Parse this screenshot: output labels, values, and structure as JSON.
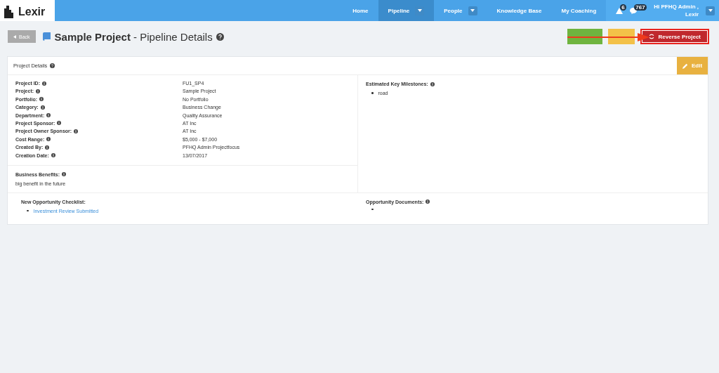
{
  "logo": "Lexir",
  "nav": [
    {
      "label": "Home",
      "selected": false,
      "dropdown": false
    },
    {
      "label": "Pipeline",
      "selected": true,
      "dropdown": true
    },
    {
      "label": "People",
      "selected": false,
      "dropdown": true
    },
    {
      "label": "Knowledge Base",
      "selected": false,
      "dropdown": false
    },
    {
      "label": "My Coaching",
      "selected": false,
      "dropdown": false
    }
  ],
  "alerts": [
    {
      "kind": "warning",
      "count": "6"
    },
    {
      "kind": "chat",
      "count": "767"
    }
  ],
  "user": {
    "greeting": "Hi PFHQ Admin ,",
    "org": "Lexir"
  },
  "header": {
    "back": "Back",
    "title_bold": "Sample Project",
    "title_rest": " - Pipeline Details"
  },
  "actions": [
    {
      "kind": "review"
    },
    {
      "kind": "warn"
    },
    {
      "kind": "reverse",
      "label": "Reverse Project",
      "highlighted": true
    }
  ],
  "panel": {
    "title": "Project Details",
    "edit": "Edit",
    "fields": [
      {
        "label": "Project ID:",
        "value": "FU1_SP4"
      },
      {
        "label": "Project:",
        "value": "Sample Project"
      },
      {
        "label": "Portfolio:",
        "value": "No Portfolio"
      },
      {
        "label": "Category:",
        "value": "Business Change"
      },
      {
        "label": "Department:",
        "value": "Quality Assurance"
      },
      {
        "label": "Project Sponsor:",
        "value": "AT Inc"
      },
      {
        "label": "Project Owner Sponsor:",
        "value": "AT Inc"
      },
      {
        "label": "Cost Range:",
        "value": "$5,000 - $7,000"
      },
      {
        "label": "Created By:",
        "value": "PFHQ Admin Projectfocus"
      },
      {
        "label": "Creation Date:",
        "value": "13/07/2017"
      }
    ],
    "benefits": {
      "label": "Business Benefits:",
      "text": "big benefit in the future"
    },
    "milestones": {
      "label": "Estimated Key Milestones:",
      "items": [
        "road"
      ]
    },
    "checklist": {
      "label": "New Opportunity Checklist:",
      "items": [
        "Investment Review Submitted"
      ]
    },
    "documents": {
      "label": "Opportunity Documents:"
    }
  }
}
